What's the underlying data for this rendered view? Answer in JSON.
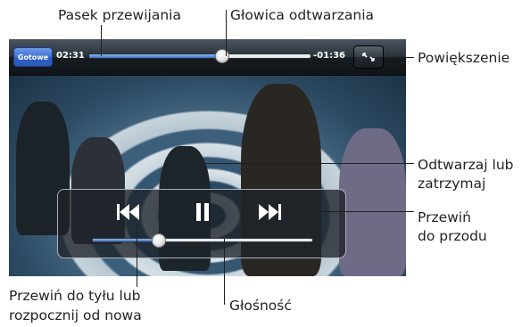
{
  "player": {
    "done_label": "Gotowe",
    "elapsed": "02:31",
    "remaining": "-01:36",
    "playback_progress": 0.6,
    "volume_level": 0.3,
    "state": "playing",
    "accent_color": "#3f74cf",
    "icons": {
      "zoom": "zoom-toggle-icon",
      "previous": "skip-back-icon",
      "play_pause": "pause-icon",
      "next": "skip-forward-icon"
    }
  },
  "callouts": {
    "scrubber_bar": "Pasek przewijania",
    "playhead": "Głowica odtwarzania",
    "zoom": "Powiększenie",
    "play_pause_line1": "Odtwarzaj lub",
    "play_pause_line2": "zatrzymaj",
    "next_line1": "Przewiń",
    "next_line2": "do przodu",
    "previous_line1": "Przewiń do tyłu lub",
    "previous_line2": "rozpocznij od nowa",
    "volume": "Głośność"
  }
}
